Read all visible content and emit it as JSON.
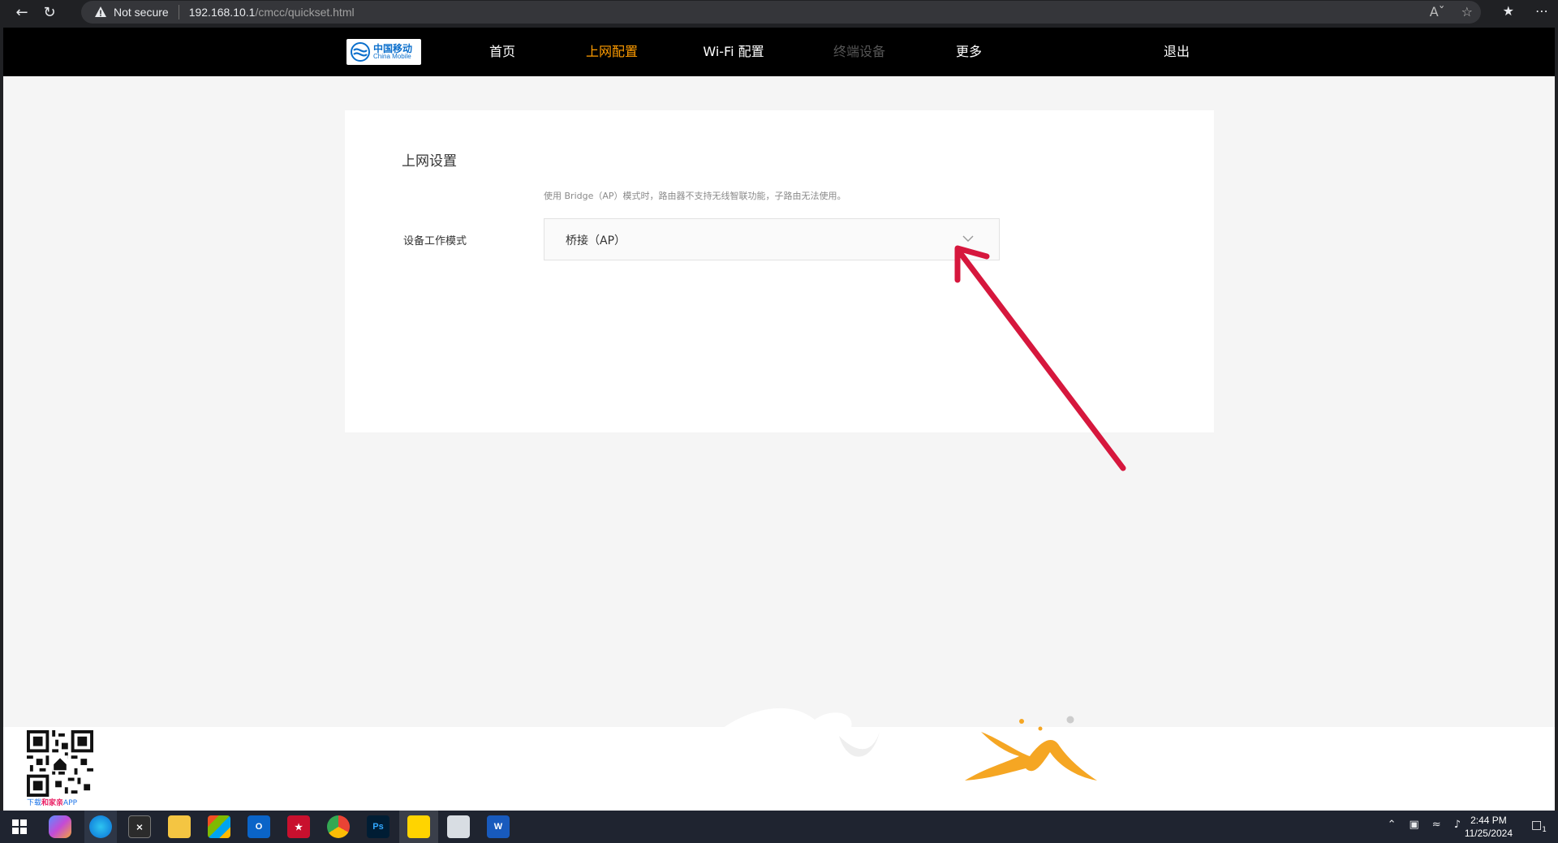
{
  "browser": {
    "security_label": "Not secure",
    "url_host": "192.168.10.1",
    "url_path": "/cmcc/quickset.html",
    "icons": [
      "back-icon",
      "reload-icon",
      "warning-icon",
      "read-aloud-icon",
      "favorite-icon",
      "collections-icon",
      "more-icon"
    ]
  },
  "router_nav": {
    "logo_cn": "中国移动",
    "logo_en": "China Mobile",
    "items": [
      {
        "label": "首页",
        "state": "normal"
      },
      {
        "label": "上网配置",
        "state": "active"
      },
      {
        "label": "Wi-Fi 配置",
        "state": "normal"
      },
      {
        "label": "终端设备",
        "state": "disabled"
      },
      {
        "label": "更多",
        "state": "normal"
      }
    ],
    "logout_label": "退出"
  },
  "card": {
    "title": "上网设置",
    "hint": "使用 Bridge（AP）模式时，路由器不支持无线智联功能，子路由无法使用。",
    "field_label": "设备工作模式",
    "select_value": "桥接（AP）"
  },
  "footer": {
    "qr_caption_prefix": "下载",
    "qr_caption_brand": "和家亲",
    "qr_caption_suffix": "APP"
  },
  "taskbar": {
    "time": "2:44 PM",
    "date": "11/25/2024",
    "notification_count": "1"
  },
  "colors": {
    "accent": "#ff9c00",
    "annotation_arrow": "#d6173d",
    "nav_bg": "#000000",
    "page_bg": "#f5f5f5"
  }
}
